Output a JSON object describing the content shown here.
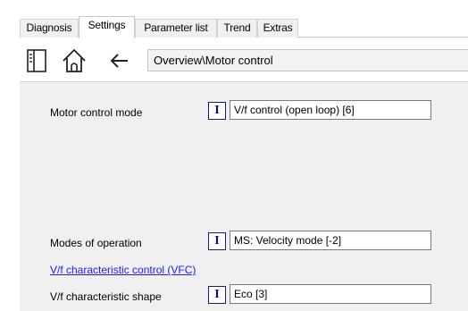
{
  "tabs": [
    {
      "label": "Diagnosis",
      "active": false
    },
    {
      "label": "Settings",
      "active": true
    },
    {
      "label": "Parameter list",
      "active": false
    },
    {
      "label": "Trend",
      "active": false
    },
    {
      "label": "Extras",
      "active": false
    }
  ],
  "toolbar": {
    "icons": [
      "panel-toggle-icon",
      "home-icon",
      "back-arrow-icon"
    ],
    "breadcrumb": "Overview\\Motor control"
  },
  "parameters": {
    "motor_control_mode": {
      "label": "Motor control mode",
      "badge": "I",
      "value": "V/f control (open loop) [6]"
    },
    "modes_of_operation": {
      "label": "Modes of operation",
      "badge": "I",
      "value": "MS: Velocity mode [-2]"
    },
    "vfc_link": "V/f characteristic control (VFC)",
    "vf_shape": {
      "label": "V/f characteristic shape",
      "badge": "I",
      "value": "Eco [3]"
    }
  },
  "colors": {
    "link": "#1a1aff",
    "badge": "#0a0a8a",
    "panel": "#f0f0f0"
  }
}
